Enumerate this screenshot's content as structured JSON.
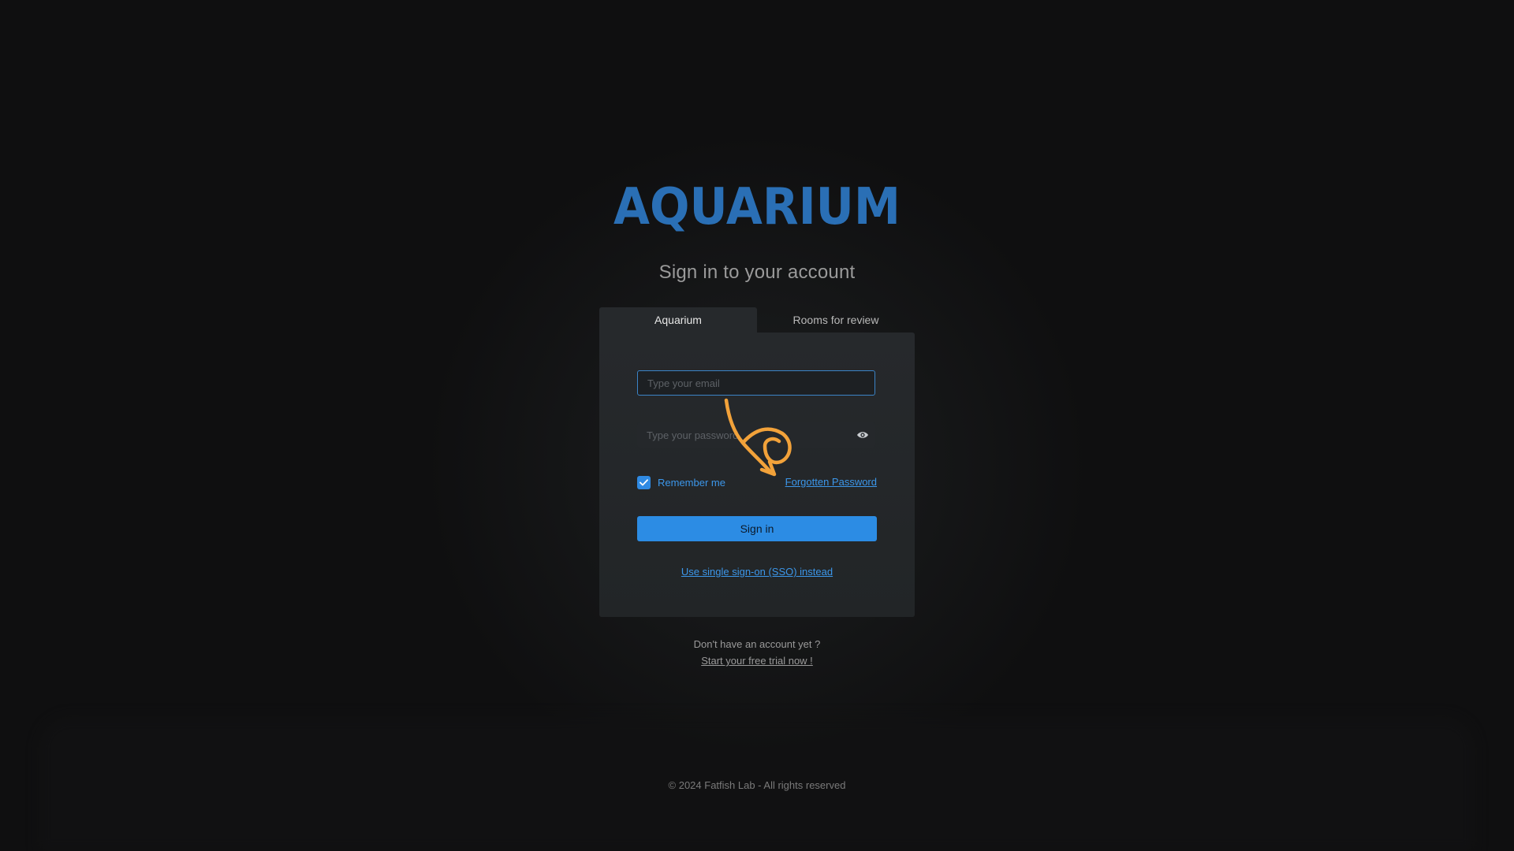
{
  "brand": {
    "logo_text": "AQUARIUM",
    "logo_color": "#2a6fb5"
  },
  "heading": "Sign in to your account",
  "tabs": [
    {
      "label": "Aquarium",
      "active": true
    },
    {
      "label": "Rooms for review",
      "active": false
    }
  ],
  "form": {
    "email_placeholder": "Type your email",
    "email_value": "",
    "password_placeholder": "Type your password",
    "password_value": "",
    "password_toggle_icon": "eye-icon",
    "remember_label": "Remember me",
    "remember_checked": true,
    "forgot_label": "Forgotten Password",
    "signin_label": "Sign in",
    "sso_label": "Use single sign-on (SSO) instead"
  },
  "signup": {
    "prompt": "Don't have an account yet ?",
    "link_label": "Start your free trial now !"
  },
  "footer": {
    "copyright": "© 2024 Fatfish Lab - All rights reserved"
  },
  "colors": {
    "accent": "#2c8ce4",
    "link": "#3c97ea",
    "annotation": "#f2a23a",
    "background": "#0e0e0f",
    "card": "#26292c"
  }
}
